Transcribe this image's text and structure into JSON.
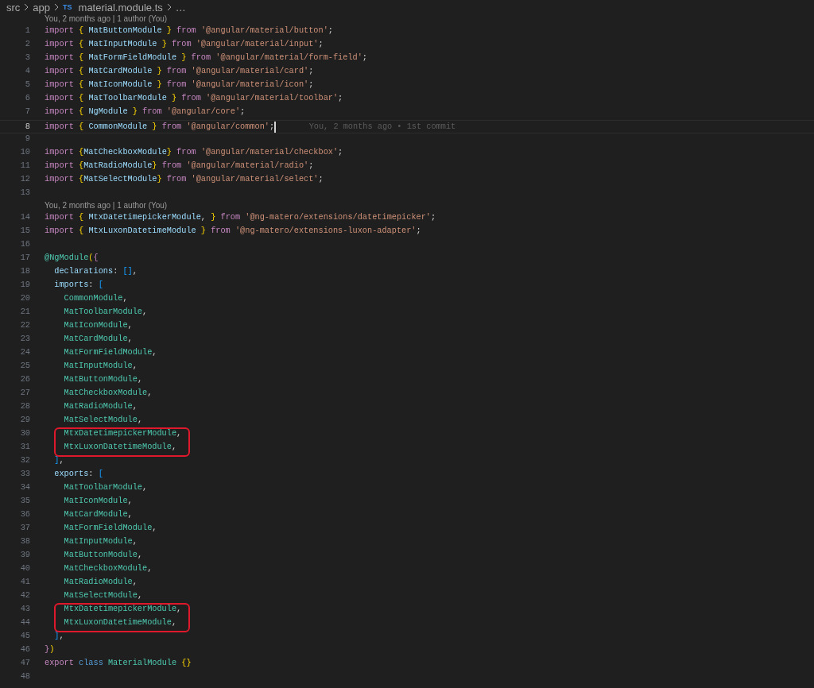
{
  "breadcrumb": [
    {
      "kind": "folder",
      "text": "src"
    },
    {
      "kind": "folder",
      "text": "app"
    },
    {
      "kind": "file",
      "icon": "TS",
      "text": "material.module.ts"
    },
    {
      "kind": "more",
      "text": "…"
    }
  ],
  "lines": [
    {
      "kind": "codelens",
      "text": "You, 2 months ago | 1 author (You)"
    },
    {
      "kind": "code",
      "number": "1",
      "active": false,
      "boxed": false,
      "tokens": [
        {
          "kind": "keyword",
          "text": "import "
        },
        {
          "kind": "brace",
          "text": "{ "
        },
        {
          "kind": "name",
          "text": "MatButtonModule "
        },
        {
          "kind": "brace",
          "text": "} "
        },
        {
          "kind": "keyword",
          "text": "from "
        },
        {
          "kind": "string",
          "text": "'@angular/material/button'"
        },
        {
          "kind": "plain",
          "text": ";"
        }
      ]
    },
    {
      "kind": "code",
      "number": "2",
      "active": false,
      "boxed": false,
      "tokens": [
        {
          "kind": "keyword",
          "text": "import "
        },
        {
          "kind": "brace",
          "text": "{ "
        },
        {
          "kind": "name",
          "text": "MatInputModule "
        },
        {
          "kind": "brace",
          "text": "} "
        },
        {
          "kind": "keyword",
          "text": "from "
        },
        {
          "kind": "string",
          "text": "'@angular/material/input'"
        },
        {
          "kind": "plain",
          "text": ";"
        }
      ]
    },
    {
      "kind": "code",
      "number": "3",
      "active": false,
      "boxed": false,
      "tokens": [
        {
          "kind": "keyword",
          "text": "import "
        },
        {
          "kind": "brace",
          "text": "{ "
        },
        {
          "kind": "name",
          "text": "MatFormFieldModule "
        },
        {
          "kind": "brace",
          "text": "} "
        },
        {
          "kind": "keyword",
          "text": "from "
        },
        {
          "kind": "string",
          "text": "'@angular/material/form-field'"
        },
        {
          "kind": "plain",
          "text": ";"
        }
      ]
    },
    {
      "kind": "code",
      "number": "4",
      "active": false,
      "boxed": false,
      "tokens": [
        {
          "kind": "keyword",
          "text": "import "
        },
        {
          "kind": "brace",
          "text": "{ "
        },
        {
          "kind": "name",
          "text": "MatCardModule "
        },
        {
          "kind": "brace",
          "text": "} "
        },
        {
          "kind": "keyword",
          "text": "from "
        },
        {
          "kind": "string",
          "text": "'@angular/material/card'"
        },
        {
          "kind": "plain",
          "text": ";"
        }
      ]
    },
    {
      "kind": "code",
      "number": "5",
      "active": false,
      "boxed": false,
      "tokens": [
        {
          "kind": "keyword",
          "text": "import "
        },
        {
          "kind": "brace",
          "text": "{ "
        },
        {
          "kind": "name",
          "text": "MatIconModule "
        },
        {
          "kind": "brace",
          "text": "} "
        },
        {
          "kind": "keyword",
          "text": "from "
        },
        {
          "kind": "string",
          "text": "'@angular/material/icon'"
        },
        {
          "kind": "plain",
          "text": ";"
        }
      ]
    },
    {
      "kind": "code",
      "number": "6",
      "active": false,
      "boxed": false,
      "tokens": [
        {
          "kind": "keyword",
          "text": "import "
        },
        {
          "kind": "brace",
          "text": "{ "
        },
        {
          "kind": "name",
          "text": "MatToolbarModule "
        },
        {
          "kind": "brace",
          "text": "} "
        },
        {
          "kind": "keyword",
          "text": "from "
        },
        {
          "kind": "string",
          "text": "'@angular/material/toolbar'"
        },
        {
          "kind": "plain",
          "text": ";"
        }
      ]
    },
    {
      "kind": "code",
      "number": "7",
      "active": false,
      "boxed": false,
      "tokens": [
        {
          "kind": "keyword",
          "text": "import "
        },
        {
          "kind": "brace",
          "text": "{ "
        },
        {
          "kind": "name",
          "text": "NgModule "
        },
        {
          "kind": "brace",
          "text": "} "
        },
        {
          "kind": "keyword",
          "text": "from "
        },
        {
          "kind": "string",
          "text": "'@angular/core'"
        },
        {
          "kind": "plain",
          "text": ";"
        }
      ]
    },
    {
      "kind": "code",
      "number": "8",
      "active": true,
      "boxed": false,
      "blame": "You, 2 months ago • 1st commit",
      "tokens": [
        {
          "kind": "keyword",
          "text": "import "
        },
        {
          "kind": "brace",
          "text": "{ "
        },
        {
          "kind": "name",
          "text": "CommonModule "
        },
        {
          "kind": "brace",
          "text": "} "
        },
        {
          "kind": "keyword",
          "text": "from "
        },
        {
          "kind": "string",
          "text": "'@angular/common'"
        },
        {
          "kind": "plain",
          "text": ";"
        }
      ]
    },
    {
      "kind": "code",
      "number": "9",
      "active": false,
      "boxed": false
    },
    {
      "kind": "code",
      "number": "10",
      "active": false,
      "boxed": false,
      "tokens": [
        {
          "kind": "keyword",
          "text": "import "
        },
        {
          "kind": "brace",
          "text": "{"
        },
        {
          "kind": "name",
          "text": "MatCheckboxModule"
        },
        {
          "kind": "brace",
          "text": "} "
        },
        {
          "kind": "keyword",
          "text": "from "
        },
        {
          "kind": "string",
          "text": "'@angular/material/checkbox'"
        },
        {
          "kind": "plain",
          "text": ";"
        }
      ]
    },
    {
      "kind": "code",
      "number": "11",
      "active": false,
      "boxed": false,
      "tokens": [
        {
          "kind": "keyword",
          "text": "import "
        },
        {
          "kind": "brace",
          "text": "{"
        },
        {
          "kind": "name",
          "text": "MatRadioModule"
        },
        {
          "kind": "brace",
          "text": "} "
        },
        {
          "kind": "keyword",
          "text": "from "
        },
        {
          "kind": "string",
          "text": "'@angular/material/radio'"
        },
        {
          "kind": "plain",
          "text": ";"
        }
      ]
    },
    {
      "kind": "code",
      "number": "12",
      "active": false,
      "boxed": false,
      "tokens": [
        {
          "kind": "keyword",
          "text": "import "
        },
        {
          "kind": "brace",
          "text": "{"
        },
        {
          "kind": "name",
          "text": "MatSelectModule"
        },
        {
          "kind": "brace",
          "text": "} "
        },
        {
          "kind": "keyword",
          "text": "from "
        },
        {
          "kind": "string",
          "text": "'@angular/material/select'"
        },
        {
          "kind": "plain",
          "text": ";"
        }
      ]
    },
    {
      "kind": "code",
      "number": "13",
      "active": false,
      "boxed": false
    },
    {
      "kind": "codelens",
      "text": "You, 2 months ago | 1 author (You)"
    },
    {
      "kind": "code",
      "number": "14",
      "active": false,
      "boxed": false,
      "tokens": [
        {
          "kind": "keyword",
          "text": "import "
        },
        {
          "kind": "brace",
          "text": "{ "
        },
        {
          "kind": "name",
          "text": "MtxDatetimepickerModule"
        },
        {
          "kind": "plain",
          "text": ", "
        },
        {
          "kind": "brace",
          "text": "} "
        },
        {
          "kind": "keyword",
          "text": "from "
        },
        {
          "kind": "string",
          "text": "'@ng-matero/extensions/datetimepicker'"
        },
        {
          "kind": "plain",
          "text": ";"
        }
      ]
    },
    {
      "kind": "code",
      "number": "15",
      "active": false,
      "boxed": false,
      "tokens": [
        {
          "kind": "keyword",
          "text": "import "
        },
        {
          "kind": "brace",
          "text": "{ "
        },
        {
          "kind": "name",
          "text": "MtxLuxonDatetimeModule "
        },
        {
          "kind": "brace",
          "text": "} "
        },
        {
          "kind": "keyword",
          "text": "from "
        },
        {
          "kind": "string",
          "text": "'@ng-matero/extensions-luxon-adapter'"
        },
        {
          "kind": "plain",
          "text": ";"
        }
      ]
    },
    {
      "kind": "code",
      "number": "16",
      "active": false,
      "boxed": false
    },
    {
      "kind": "code",
      "number": "17",
      "active": false,
      "boxed": false,
      "tokens": [
        {
          "kind": "decorator",
          "text": "@NgModule"
        },
        {
          "kind": "brace",
          "text": "("
        },
        {
          "kind": "keyword",
          "text": "{"
        }
      ]
    },
    {
      "kind": "code",
      "number": "18",
      "active": false,
      "boxed": false,
      "tokens": [
        {
          "kind": "property",
          "text": "  declarations"
        },
        {
          "kind": "plain",
          "text": ": "
        },
        {
          "kind": "bracket",
          "text": "[]"
        },
        {
          "kind": "plain",
          "text": ","
        }
      ]
    },
    {
      "kind": "code",
      "number": "19",
      "active": false,
      "boxed": false,
      "tokens": [
        {
          "kind": "property",
          "text": "  imports"
        },
        {
          "kind": "plain",
          "text": ": "
        },
        {
          "kind": "bracket",
          "text": "["
        }
      ]
    },
    {
      "kind": "code",
      "number": "20",
      "active": false,
      "boxed": false,
      "tokens": [
        {
          "kind": "module",
          "text": "    CommonModule"
        },
        {
          "kind": "plain",
          "text": ","
        }
      ]
    },
    {
      "kind": "code",
      "number": "21",
      "active": false,
      "boxed": false,
      "tokens": [
        {
          "kind": "module",
          "text": "    MatToolbarModule"
        },
        {
          "kind": "plain",
          "text": ","
        }
      ]
    },
    {
      "kind": "code",
      "number": "22",
      "active": false,
      "boxed": false,
      "tokens": [
        {
          "kind": "module",
          "text": "    MatIconModule"
        },
        {
          "kind": "plain",
          "text": ","
        }
      ]
    },
    {
      "kind": "code",
      "number": "23",
      "active": false,
      "boxed": false,
      "tokens": [
        {
          "kind": "module",
          "text": "    MatCardModule"
        },
        {
          "kind": "plain",
          "text": ","
        }
      ]
    },
    {
      "kind": "code",
      "number": "24",
      "active": false,
      "boxed": false,
      "tokens": [
        {
          "kind": "module",
          "text": "    MatFormFieldModule"
        },
        {
          "kind": "plain",
          "text": ","
        }
      ]
    },
    {
      "kind": "code",
      "number": "25",
      "active": false,
      "boxed": false,
      "tokens": [
        {
          "kind": "module",
          "text": "    MatInputModule"
        },
        {
          "kind": "plain",
          "text": ","
        }
      ]
    },
    {
      "kind": "code",
      "number": "26",
      "active": false,
      "boxed": false,
      "tokens": [
        {
          "kind": "module",
          "text": "    MatButtonModule"
        },
        {
          "kind": "plain",
          "text": ","
        }
      ]
    },
    {
      "kind": "code",
      "number": "27",
      "active": false,
      "boxed": false,
      "tokens": [
        {
          "kind": "module",
          "text": "    MatCheckboxModule"
        },
        {
          "kind": "plain",
          "text": ","
        }
      ]
    },
    {
      "kind": "code",
      "number": "28",
      "active": false,
      "boxed": false,
      "tokens": [
        {
          "kind": "module",
          "text": "    MatRadioModule"
        },
        {
          "kind": "plain",
          "text": ","
        }
      ]
    },
    {
      "kind": "code",
      "number": "29",
      "active": false,
      "boxed": false,
      "tokens": [
        {
          "kind": "module",
          "text": "    MatSelectModule"
        },
        {
          "kind": "plain",
          "text": ","
        }
      ]
    },
    {
      "kind": "code",
      "number": "30",
      "active": false,
      "boxed": true,
      "tokens": [
        {
          "kind": "module",
          "text": "    MtxDatetimepickerModule"
        },
        {
          "kind": "plain",
          "text": ","
        }
      ]
    },
    {
      "kind": "code",
      "number": "31",
      "active": false,
      "boxed": true,
      "tokens": [
        {
          "kind": "module",
          "text": "    MtxLuxonDatetimeModule"
        },
        {
          "kind": "plain",
          "text": ","
        }
      ]
    },
    {
      "kind": "code",
      "number": "32",
      "active": false,
      "boxed": false,
      "tokens": [
        {
          "kind": "bracket",
          "text": "  ]"
        },
        {
          "kind": "plain",
          "text": ","
        }
      ]
    },
    {
      "kind": "code",
      "number": "33",
      "active": false,
      "boxed": false,
      "tokens": [
        {
          "kind": "property",
          "text": "  exports"
        },
        {
          "kind": "plain",
          "text": ": "
        },
        {
          "kind": "bracket",
          "text": "["
        }
      ]
    },
    {
      "kind": "code",
      "number": "34",
      "active": false,
      "boxed": false,
      "tokens": [
        {
          "kind": "module",
          "text": "    MatToolbarModule"
        },
        {
          "kind": "plain",
          "text": ","
        }
      ]
    },
    {
      "kind": "code",
      "number": "35",
      "active": false,
      "boxed": false,
      "tokens": [
        {
          "kind": "module",
          "text": "    MatIconModule"
        },
        {
          "kind": "plain",
          "text": ","
        }
      ]
    },
    {
      "kind": "code",
      "number": "36",
      "active": false,
      "boxed": false,
      "tokens": [
        {
          "kind": "module",
          "text": "    MatCardModule"
        },
        {
          "kind": "plain",
          "text": ","
        }
      ]
    },
    {
      "kind": "code",
      "number": "37",
      "active": false,
      "boxed": false,
      "tokens": [
        {
          "kind": "module",
          "text": "    MatFormFieldModule"
        },
        {
          "kind": "plain",
          "text": ","
        }
      ]
    },
    {
      "kind": "code",
      "number": "38",
      "active": false,
      "boxed": false,
      "tokens": [
        {
          "kind": "module",
          "text": "    MatInputModule"
        },
        {
          "kind": "plain",
          "text": ","
        }
      ]
    },
    {
      "kind": "code",
      "number": "39",
      "active": false,
      "boxed": false,
      "tokens": [
        {
          "kind": "module",
          "text": "    MatButtonModule"
        },
        {
          "kind": "plain",
          "text": ","
        }
      ]
    },
    {
      "kind": "code",
      "number": "40",
      "active": false,
      "boxed": false,
      "tokens": [
        {
          "kind": "module",
          "text": "    MatCheckboxModule"
        },
        {
          "kind": "plain",
          "text": ","
        }
      ]
    },
    {
      "kind": "code",
      "number": "41",
      "active": false,
      "boxed": false,
      "tokens": [
        {
          "kind": "module",
          "text": "    MatRadioModule"
        },
        {
          "kind": "plain",
          "text": ","
        }
      ]
    },
    {
      "kind": "code",
      "number": "42",
      "active": false,
      "boxed": false,
      "tokens": [
        {
          "kind": "module",
          "text": "    MatSelectModule"
        },
        {
          "kind": "plain",
          "text": ","
        }
      ]
    },
    {
      "kind": "code",
      "number": "43",
      "active": false,
      "boxed": true,
      "tokens": [
        {
          "kind": "module",
          "text": "    MtxDatetimepickerModule"
        },
        {
          "kind": "plain",
          "text": ","
        }
      ]
    },
    {
      "kind": "code",
      "number": "44",
      "active": false,
      "boxed": true,
      "tokens": [
        {
          "kind": "module",
          "text": "    MtxLuxonDatetimeModule"
        },
        {
          "kind": "plain",
          "text": ","
        }
      ]
    },
    {
      "kind": "code",
      "number": "45",
      "active": false,
      "boxed": false,
      "tokens": [
        {
          "kind": "bracket",
          "text": "  ]"
        },
        {
          "kind": "plain",
          "text": ","
        }
      ]
    },
    {
      "kind": "code",
      "number": "46",
      "active": false,
      "boxed": false,
      "tokens": [
        {
          "kind": "keyword",
          "text": "}"
        },
        {
          "kind": "brace",
          "text": ")"
        }
      ]
    },
    {
      "kind": "code",
      "number": "47",
      "active": false,
      "boxed": false,
      "tokens": [
        {
          "kind": "keyword",
          "text": "export "
        },
        {
          "kind": "keyword2",
          "text": "class "
        },
        {
          "kind": "module",
          "text": "MaterialModule "
        },
        {
          "kind": "brace",
          "text": "{}"
        }
      ]
    },
    {
      "kind": "code",
      "number": "48",
      "active": false,
      "boxed": false
    }
  ]
}
